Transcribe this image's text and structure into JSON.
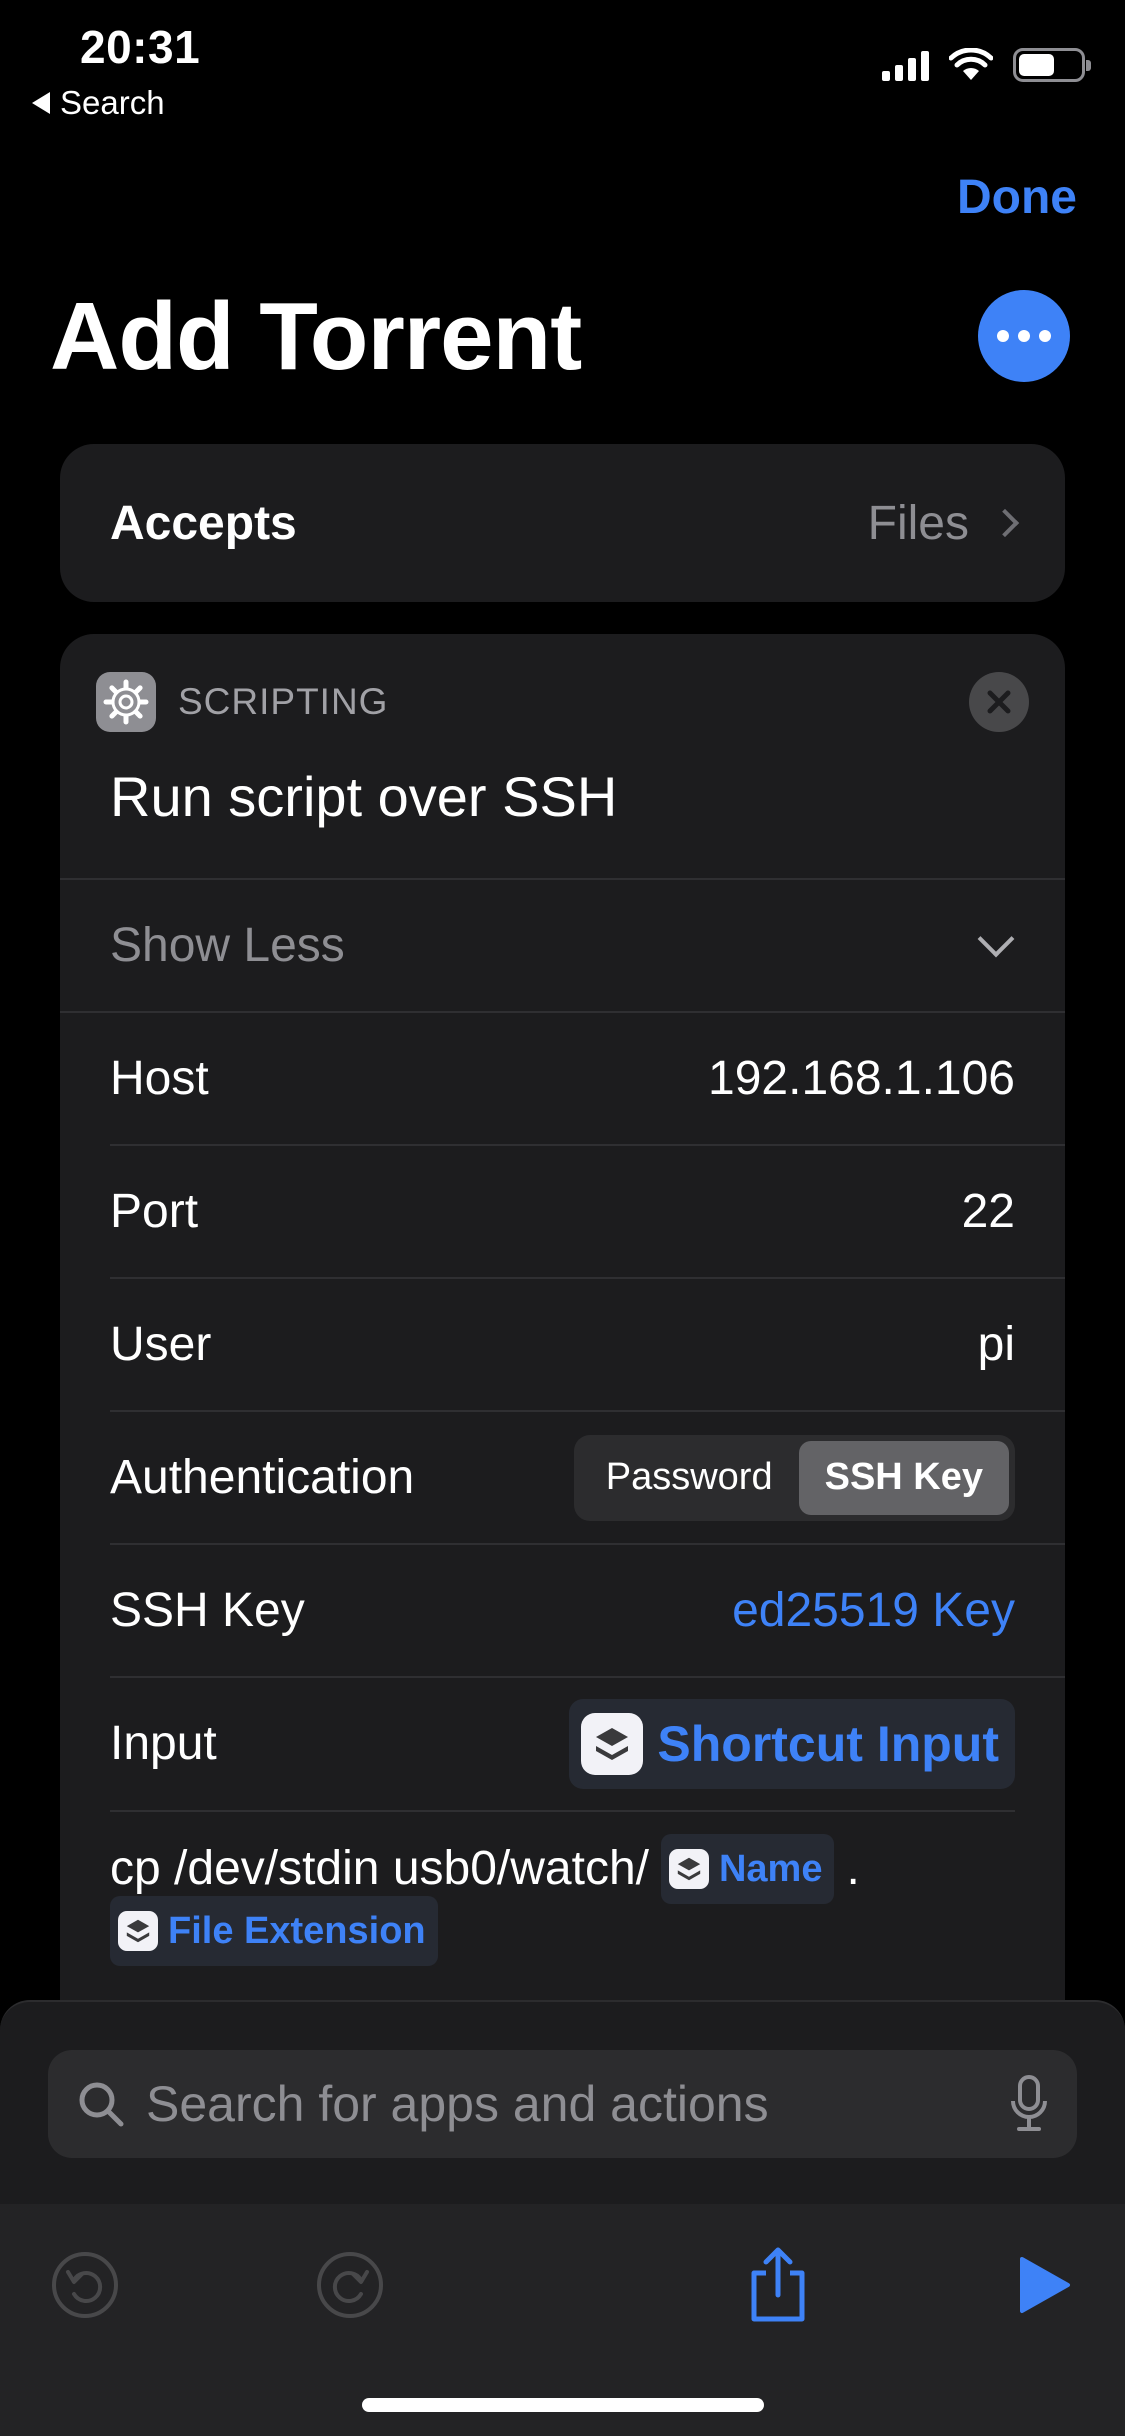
{
  "status_bar": {
    "time": "20:31",
    "back_label": "Search"
  },
  "header": {
    "done_label": "Done",
    "title": "Add Torrent"
  },
  "accepts": {
    "label": "Accepts",
    "value": "Files"
  },
  "action": {
    "category": "SCRIPTING",
    "title": "Run script over SSH",
    "show_less_label": "Show Less",
    "fields": {
      "host": {
        "label": "Host",
        "value": "192.168.1.106"
      },
      "port": {
        "label": "Port",
        "value": "22"
      },
      "user": {
        "label": "User",
        "value": "pi"
      },
      "authentication": {
        "label": "Authentication",
        "options": [
          "Password",
          "SSH Key"
        ],
        "selected": "SSH Key"
      },
      "ssh_key": {
        "label": "SSH Key",
        "value": "ed25519 Key"
      },
      "input": {
        "label": "Input",
        "value": "Shortcut Input"
      }
    },
    "script": {
      "text_1": "cp /dev/stdin usb0/watch/",
      "token_name": "Name",
      "text_2": ".",
      "token_extension": "File Extension"
    }
  },
  "search": {
    "placeholder": "Search for apps and actions"
  },
  "colors": {
    "accent": "#3e82f7",
    "background": "#000000",
    "card": "#1c1c1e"
  }
}
